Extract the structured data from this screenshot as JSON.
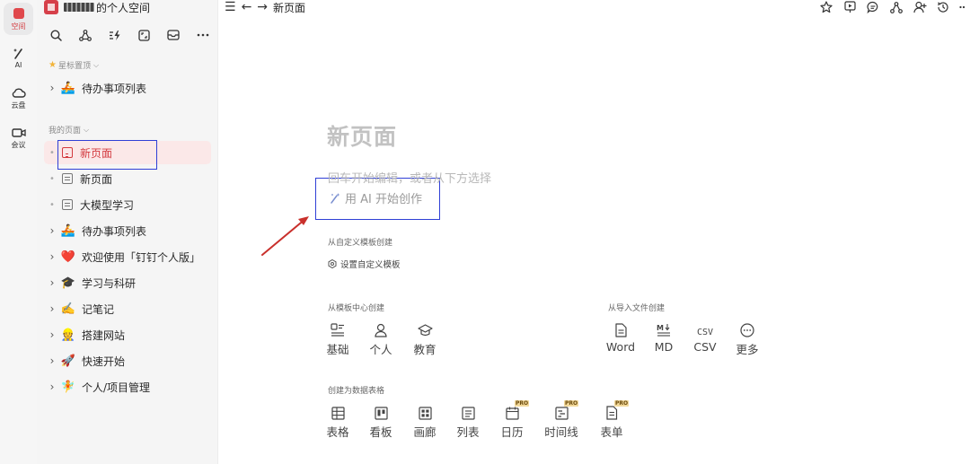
{
  "rail": {
    "space_label": "空间",
    "ai_label": "AI",
    "cloud_label": "云盘",
    "meeting_label": "会议"
  },
  "sidebar": {
    "space_title": "的个人空间",
    "starred_label": "星标置顶",
    "starred_items": [
      {
        "label": "待办事项列表",
        "emoji": "🚣"
      }
    ],
    "my_pages_label": "我的页面",
    "pages": [
      {
        "label": "新页面",
        "kind": "doc"
      },
      {
        "label": "新页面",
        "kind": "doc"
      },
      {
        "label": "大模型学习",
        "kind": "doc"
      },
      {
        "label": "待办事项列表",
        "kind": "emoji",
        "emoji": "🚣"
      },
      {
        "label": "欢迎使用「钉钉个人版」",
        "kind": "emoji",
        "emoji": "❤️"
      },
      {
        "label": "学习与科研",
        "kind": "emoji",
        "emoji": "🎓"
      },
      {
        "label": "记笔记",
        "kind": "emoji",
        "emoji": "✍️"
      },
      {
        "label": "搭建网站",
        "kind": "emoji",
        "emoji": "👷"
      },
      {
        "label": "快速开始",
        "kind": "emoji",
        "emoji": "🚀"
      },
      {
        "label": "个人/项目管理",
        "kind": "emoji",
        "emoji": "🧚"
      }
    ]
  },
  "topbar": {
    "title": "新页面"
  },
  "main": {
    "page_title": "新页面",
    "hint": "回车开始编辑，或者从下方选择",
    "ai_start": "用 AI 开始创作",
    "custom_group": "从自定义模板创建",
    "custom_action": "设置自定义模板",
    "template_group": "从模板中心创建",
    "templates": [
      {
        "label": "基础",
        "icon": "layout-icon"
      },
      {
        "label": "个人",
        "icon": "person-icon"
      },
      {
        "label": "教育",
        "icon": "mortarboard-icon"
      }
    ],
    "import_group": "从导入文件创建",
    "imports": [
      {
        "label": "Word",
        "icon": "word-doc-icon"
      },
      {
        "label": "MD",
        "icon": "markdown-icon"
      },
      {
        "label": "CSV",
        "icon": "csv-icon",
        "glyph": "CSV"
      },
      {
        "label": "更多",
        "icon": "more-circle-icon"
      }
    ],
    "table_group": "创建为数据表格",
    "tables": [
      {
        "label": "表格",
        "icon": "grid-icon"
      },
      {
        "label": "看板",
        "icon": "kanban-icon"
      },
      {
        "label": "画廊",
        "icon": "gallery-icon"
      },
      {
        "label": "列表",
        "icon": "list-icon"
      },
      {
        "label": "日历",
        "icon": "calendar-icon",
        "badge": "PRO"
      },
      {
        "label": "时间线",
        "icon": "timeline-icon",
        "badge": "PRO"
      },
      {
        "label": "表单",
        "icon": "form-icon",
        "badge": "PRO"
      }
    ]
  },
  "colors": {
    "accent": "#d33a3f",
    "annotation_box": "#2f3fd6",
    "annotation_arrow": "#c9302c"
  }
}
